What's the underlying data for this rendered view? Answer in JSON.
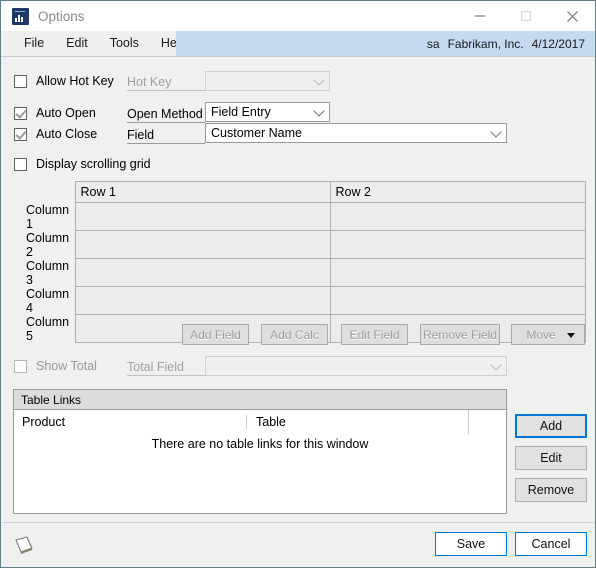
{
  "window": {
    "title": "Options",
    "icon": "chart-app-icon",
    "controls": {
      "minimize": "minimize-icon",
      "maximize": "maximize-icon",
      "close": "close-icon"
    }
  },
  "menubar": {
    "items": [
      "File",
      "Edit",
      "Tools",
      "Help"
    ],
    "status": {
      "user": "sa",
      "company": "Fabrikam, Inc.",
      "date": "4/12/2017"
    }
  },
  "options": {
    "allow_hot_key": {
      "label": "Allow Hot Key",
      "checked": false
    },
    "auto_open": {
      "label": "Auto Open",
      "checked": true
    },
    "auto_close": {
      "label": "Auto Close",
      "checked": true
    },
    "display_scrolling_grid": {
      "label": "Display scrolling grid",
      "checked": false
    },
    "hot_key": {
      "label": "Hot Key",
      "value": "",
      "enabled": false
    },
    "open_method": {
      "label": "Open Method",
      "value": "Field Entry"
    },
    "field": {
      "label": "Field",
      "value": "Customer Name"
    }
  },
  "grid": {
    "column_headers": [
      "Row 1",
      "Row 2"
    ],
    "row_labels": [
      "Column 1",
      "Column 2",
      "Column 3",
      "Column 4",
      "Column 5"
    ],
    "cells": [
      [
        "",
        ""
      ],
      [
        "",
        ""
      ],
      [
        "",
        ""
      ],
      [
        "",
        ""
      ],
      [
        "",
        ""
      ]
    ]
  },
  "field_toolbar": {
    "buttons": [
      "Add Field",
      "Add Calc",
      "Edit Field",
      "Remove Field"
    ],
    "move": {
      "label": "Move",
      "has_dropdown": true
    },
    "enabled": false
  },
  "total": {
    "show_total": {
      "label": "Show Total",
      "checked": false
    },
    "total_field": {
      "label": "Total Field",
      "value": "",
      "enabled": false
    }
  },
  "table_links": {
    "panel_title": "Table Links",
    "columns": [
      "Product",
      "Table"
    ],
    "empty_message": "There are no table links for this window",
    "buttons": [
      {
        "label": "Add",
        "focused": true
      },
      {
        "label": "Edit",
        "focused": false
      },
      {
        "label": "Remove",
        "focused": false
      }
    ]
  },
  "footer": {
    "note_icon": "note-icon",
    "save_label": "Save",
    "cancel_label": "Cancel"
  },
  "colors": {
    "status_band": "#c5d9f1",
    "window_border": "#5d8087",
    "focus_blue": "#0078d7",
    "app_icon": "#1f3864"
  }
}
